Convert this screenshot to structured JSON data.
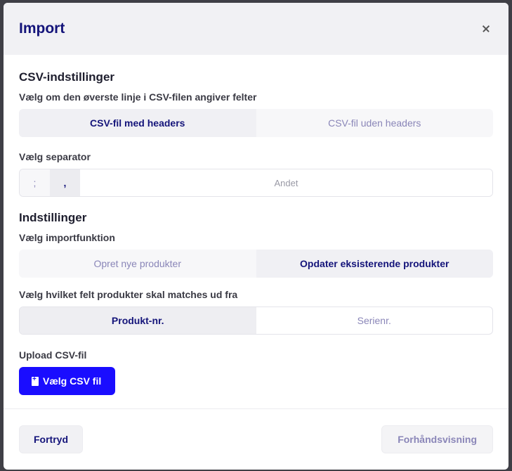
{
  "backdrop": {
    "text": "…"
  },
  "modal": {
    "title": "Import",
    "csv_settings": {
      "heading": "CSV-indstillinger",
      "header_label": "Vælg om den øverste linje i CSV-filen angiver felter",
      "header_options": [
        "CSV-fil med headers",
        "CSV-fil uden headers"
      ],
      "header_selected": 0,
      "separator_label": "Vælg separator",
      "separator_options": [
        ";",
        ","
      ],
      "separator_selected": 1,
      "separator_other_placeholder": "Andet"
    },
    "settings": {
      "heading": "Indstillinger",
      "import_label": "Vælg importfunktion",
      "import_options": [
        "Opret nye produkter",
        "Opdater eksisterende produkter"
      ],
      "import_selected": 1,
      "match_label": "Vælg hvilket felt produkter skal matches ud fra",
      "match_options": [
        "Produkt-nr.",
        "Serienr."
      ],
      "match_selected": 0
    },
    "upload": {
      "label": "Upload CSV-fil",
      "button_label": "Vælg CSV fil"
    },
    "footer": {
      "cancel_label": "Fortryd",
      "preview_label": "Forhåndsvisning"
    },
    "colors": {
      "accent": "#1a0dff",
      "title": "#14147a"
    }
  }
}
